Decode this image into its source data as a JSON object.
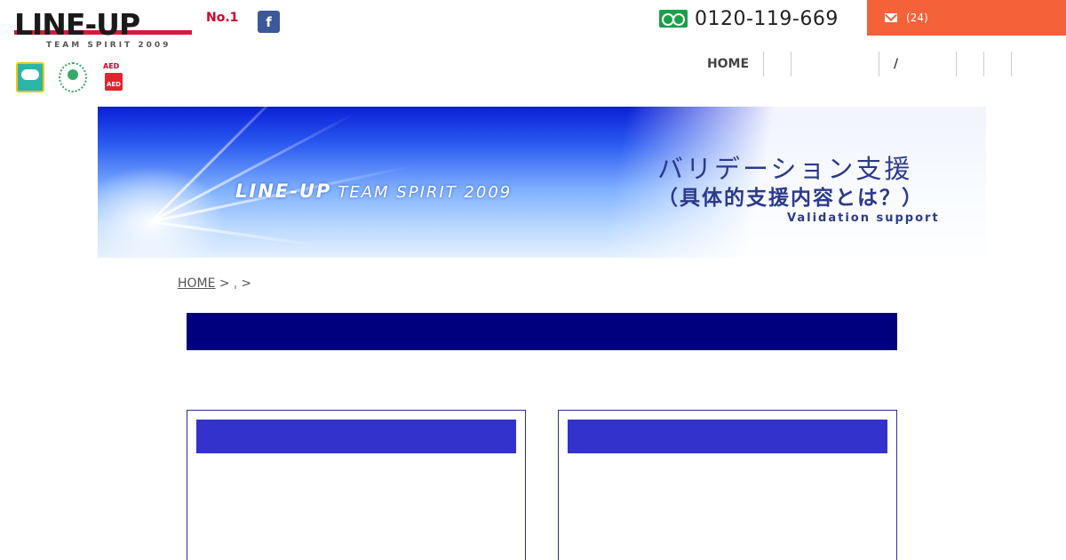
{
  "header": {
    "logo_text": "LINE-UP",
    "logo_subtext": "TEAM SPIRIT 2009",
    "no1_label": "No.1",
    "facebook_label": "f",
    "badges": [
      {
        "name": "certification-badge"
      },
      {
        "name": "green-certification-badge"
      },
      {
        "name": "aed-badge",
        "top_text": "AED",
        "box_text": "AED"
      }
    ],
    "phone": "0120-119-669",
    "contact_label": "(24)"
  },
  "nav": {
    "items": [
      {
        "label": "HOME"
      },
      {
        "label": ""
      },
      {
        "label": ""
      },
      {
        "label": "/"
      },
      {
        "label": ""
      },
      {
        "label": ""
      }
    ]
  },
  "banner": {
    "tagline_main": "LINE-UP",
    "tagline_sub": "TEAM SPIRIT 2009",
    "title_line1": "バリデーション支援",
    "title_line2": "（具体的支援内容とは？）",
    "title_line3": "Validation support"
  },
  "breadcrumb": {
    "home": "HOME",
    "rest": " > ˌ >"
  },
  "page_heading": "",
  "cards": [
    {
      "title": ""
    },
    {
      "title": ""
    }
  ],
  "colors": {
    "brand_red": "#d2002a",
    "contact_orange": "#f4623a",
    "heading_navy": "#00007f",
    "card_blue": "#3333cc",
    "facebook_blue": "#3b5998",
    "freedial_green": "#1aa04a"
  }
}
